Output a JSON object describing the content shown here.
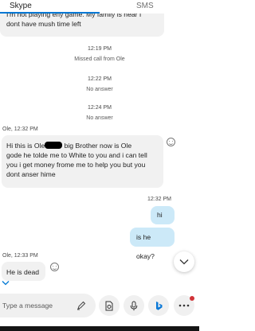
{
  "tabs": {
    "skype": "Skype",
    "sms": "SMS"
  },
  "messages": {
    "top_partial_line1": "I'm not playing eny game.  My family is near I",
    "top_partial_line2": "dont have  mush time left",
    "missed_call_time": "12:19 PM",
    "missed_call_text": "Missed call from Ole",
    "no_answer_1_time": "12:22 PM",
    "no_answer_1_text": "No answer",
    "no_answer_2_time": "12:24 PM",
    "no_answer_2_text": "No answer",
    "ole_header_1": "Ole, 12:32 PM",
    "ole_msg_line1_pre": "Hi this is Ole",
    "ole_msg_line1_post": " big Brother now is Ole",
    "ole_msg_line2": "gode he tolde me to White to you and i can tell",
    "ole_msg_line3": "you i get money frome me to help you but you",
    "ole_msg_line4": "dont anser hime",
    "my_time": "12:32 PM",
    "my_msg_1": "hi",
    "my_msg_2": "is he okay?",
    "ole_header_2": "Ole, 12:33 PM",
    "ole_msg_2": "He is dead"
  },
  "composer": {
    "placeholder": "Type a message"
  },
  "colors": {
    "accent": "#0078d4",
    "incoming_bubble": "#f1f1f1",
    "outgoing_bubble": "#cce9f8",
    "notification": "#d13438"
  },
  "icons": [
    "pen-icon",
    "media-icon",
    "microphone-icon",
    "bing-icon",
    "more-icon",
    "chevron-down-icon",
    "emoji-icon"
  ]
}
